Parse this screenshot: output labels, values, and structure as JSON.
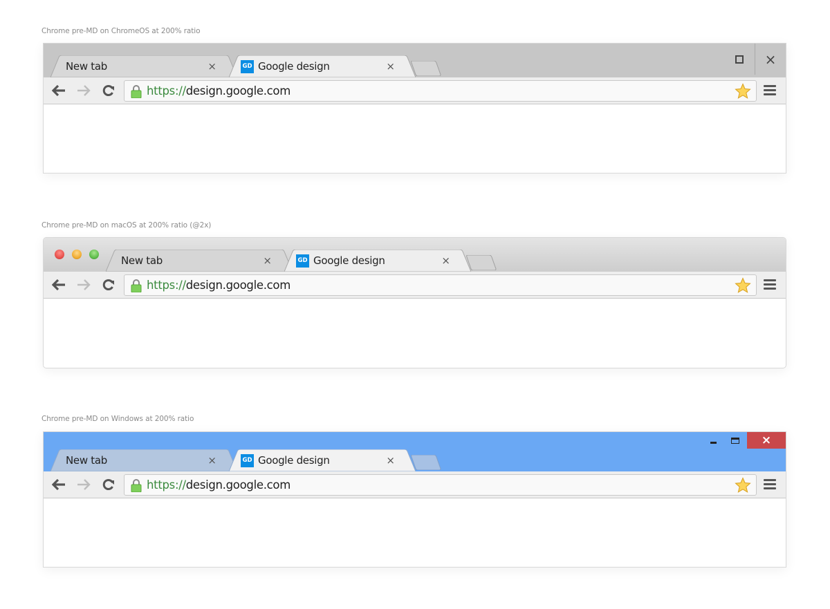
{
  "sections": [
    {
      "caption": "Chrome pre-MD on ChromeOS at 200% ratio",
      "platform": "chromeos",
      "tabs": [
        {
          "label": "New tab",
          "active": false,
          "close": "×"
        },
        {
          "label": "Google design",
          "active": true,
          "favicon": "GD",
          "close": "×"
        }
      ],
      "url_scheme": "https://",
      "url_host": "design.google.com",
      "window_controls": [
        "maximize",
        "close"
      ]
    },
    {
      "caption": "Chrome pre-MD on macOS at 200% ratio (@2x)",
      "platform": "macos",
      "tabs": [
        {
          "label": "New tab",
          "active": false,
          "close": "×"
        },
        {
          "label": "Google design",
          "active": true,
          "favicon": "GD",
          "close": "×"
        }
      ],
      "url_scheme": "https://",
      "url_host": "design.google.com",
      "window_controls": [
        "close",
        "minimize",
        "zoom"
      ]
    },
    {
      "caption": "Chrome pre-MD on Windows at 200% ratio",
      "platform": "windows",
      "tabs": [
        {
          "label": "New tab",
          "active": false,
          "close": "×"
        },
        {
          "label": "Google design",
          "active": true,
          "favicon": "GD",
          "close": "×"
        }
      ],
      "url_scheme": "https://",
      "url_host": "design.google.com",
      "window_controls": [
        "minimize",
        "maximize",
        "close"
      ]
    }
  ],
  "glyphs": {
    "close": "×"
  },
  "colors": {
    "url_scheme": "#3b8a3e",
    "favicon_bg": "#0b8de3",
    "windows_frame": "#6aa8f4",
    "windows_close": "#c9484b",
    "mac_close": "#e8524e",
    "mac_minimize": "#f0ad35",
    "mac_zoom": "#5fbd4c",
    "star": "#f9c93d"
  }
}
